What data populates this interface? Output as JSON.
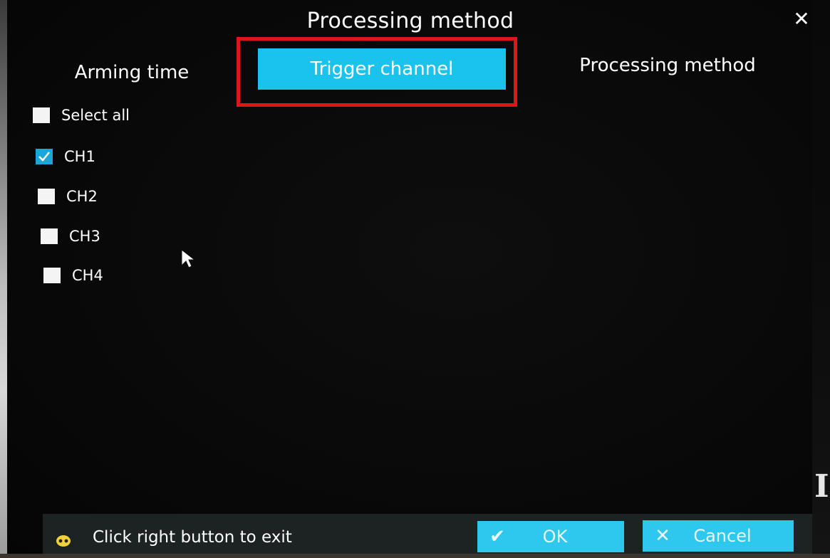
{
  "dialog": {
    "title": "Processing method",
    "close_symbol": "✕"
  },
  "tabs": [
    {
      "label": "Arming time",
      "active": false
    },
    {
      "label": "Trigger channel",
      "active": true
    },
    {
      "label": "Processing method",
      "active": false
    }
  ],
  "channels": {
    "select_all": {
      "label": "Select all",
      "checked": false
    },
    "items": [
      {
        "label": "CH1",
        "checked": true
      },
      {
        "label": "CH2",
        "checked": false
      },
      {
        "label": "CH3",
        "checked": false
      },
      {
        "label": "CH4",
        "checked": false
      }
    ]
  },
  "footer": {
    "hint": "Click right button to exit",
    "ok_label": "OK",
    "cancel_label": "Cancel",
    "ok_icon": "✔",
    "cancel_icon": "✕"
  },
  "colors": {
    "accent": "#19c3ec",
    "highlight": "#e0151b",
    "checked": "#1aa6d9"
  },
  "icons": {
    "mouse_hint": "mouse-icon",
    "cursor": "mouse-pointer-icon",
    "close": "close-icon",
    "ok": "check-icon",
    "cancel": "x-icon"
  }
}
